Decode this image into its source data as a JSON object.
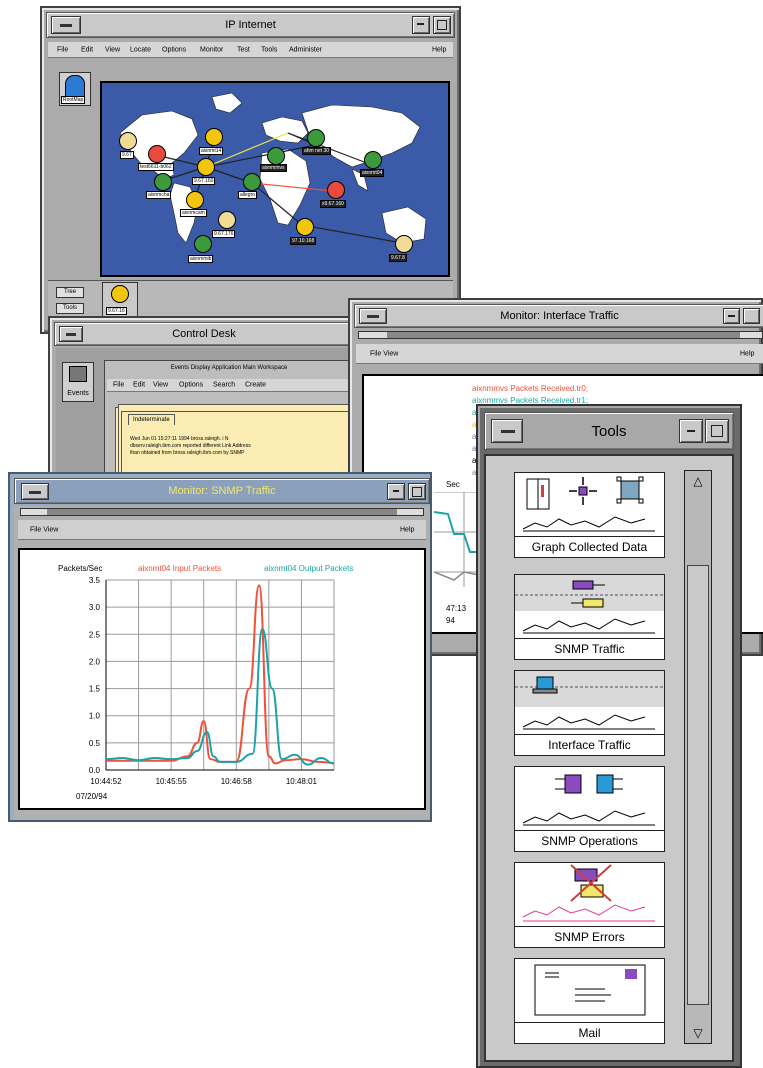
{
  "ip_window": {
    "title": "IP Internet",
    "menu": [
      "File",
      "Edit",
      "View",
      "Locate",
      "Options",
      "Monitor",
      "Test",
      "Tools",
      "Administer"
    ],
    "help": "Help",
    "side_icon_label": "RootMap",
    "tree_button": "Tree",
    "tools_button": "Tools",
    "bottom_node_label": "9.67.16",
    "map_labels": [
      "aixnmt14",
      "9.67",
      "test6611-b062",
      "9.67.160",
      "aixnmcha",
      "aixnmcam",
      "9.67.176",
      "aixnmmib",
      "allegro",
      "aixnmmvs",
      "ahm net 30",
      "aixnmt04",
      "x9.67.160",
      "97.10.168",
      "9.67.8"
    ]
  },
  "control_desk": {
    "title": "Control Desk",
    "events_label": "Events",
    "events_window_title": "Events Display Application Main Workspace",
    "events_menu": [
      "File",
      "Edit",
      "View",
      "Options",
      "Search",
      "Create"
    ],
    "card_title": "Indeterminate",
    "card_lines": [
      "Wed Jun 01  15:27:11  1994 bross.raleigh. i N",
      "dbserv.raleigh.ibm.com reported different Link Address",
      "than obtained from bross.raleigh.ibm.com by SNMP"
    ]
  },
  "interface_window": {
    "title": "Monitor: Interface Traffic",
    "menu_left": "File View",
    "help": "Help",
    "legend": [
      "aixnmmvs Packets Received.tr0;",
      "aixnmmvs Packets Received.tr1;",
      "ai",
      "ai",
      "ai",
      "ai",
      "ai",
      "ai"
    ],
    "partial_ylabel": "Sec",
    "partial_time": "47:13",
    "partial_date": "94"
  },
  "tools_window": {
    "title": "Tools",
    "items": [
      "Graph Collected Data",
      "SNMP Traffic",
      "Interface Traffic",
      "SNMP Operations",
      "SNMP Errors",
      "Mail"
    ],
    "scroll_up": "△",
    "scroll_down": "▽"
  },
  "snmp_window": {
    "title": "Monitor: SNMP Traffic",
    "menu_left": "File View",
    "help": "Help"
  },
  "chart_data": {
    "type": "line",
    "title": "",
    "ylabel": "Packets/Sec",
    "xlabel": "",
    "ylim": [
      0,
      3.5
    ],
    "yticks": [
      "0.0",
      "0.5",
      "1.0",
      "1.5",
      "2.0",
      "2.5",
      "3.0",
      "3.5"
    ],
    "xticks": [
      "10:44:52",
      "10:45:55",
      "10:46:58",
      "10:48:01"
    ],
    "date_label": "07/20/94",
    "grid": true,
    "series": [
      {
        "name": "aixnmt04 Input Packets",
        "color": "#f0503c",
        "x": [
          0,
          0.25,
          0.5,
          0.75,
          1.0,
          1.25,
          1.4,
          1.5,
          1.6,
          1.75,
          2.0,
          2.2,
          2.35,
          2.5,
          2.6,
          2.75,
          3.0,
          3.25,
          3.5
        ],
        "values": [
          0.17,
          0.17,
          0.17,
          0.17,
          0.17,
          0.25,
          0.5,
          0.9,
          0.2,
          0.15,
          0.15,
          1.5,
          3.4,
          0.25,
          0.12,
          0.18,
          0.2,
          0.15,
          0.13
        ]
      },
      {
        "name": "aixnmt04 Output Packets",
        "color": "#1aa5a5",
        "x": [
          0,
          0.25,
          0.5,
          0.75,
          1.0,
          1.25,
          1.4,
          1.55,
          1.65,
          1.75,
          2.0,
          2.25,
          2.4,
          2.55,
          2.7,
          2.9,
          3.1,
          3.3,
          3.5
        ],
        "values": [
          0.2,
          0.22,
          0.18,
          0.22,
          0.2,
          0.22,
          0.35,
          0.7,
          0.25,
          0.15,
          0.15,
          0.3,
          2.6,
          1.5,
          0.2,
          0.28,
          0.1,
          0.22,
          0.12
        ]
      }
    ]
  }
}
